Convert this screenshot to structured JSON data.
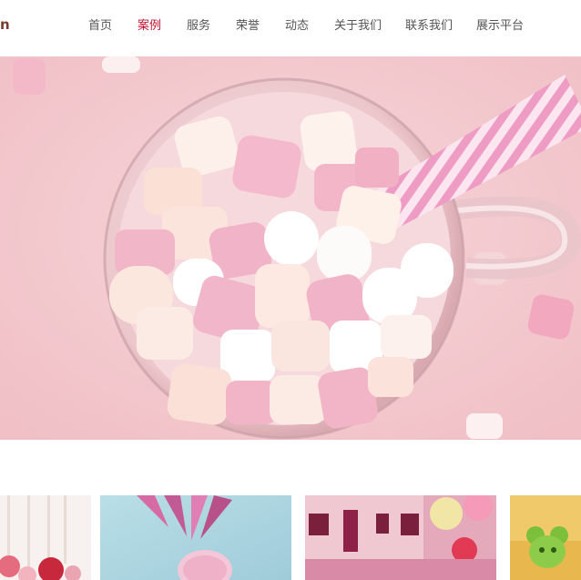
{
  "logo": {
    "text": "n"
  },
  "nav": {
    "items": [
      {
        "label": "首页",
        "active": false
      },
      {
        "label": "案例",
        "active": true
      },
      {
        "label": "服务",
        "active": false
      },
      {
        "label": "荣誉",
        "active": false
      },
      {
        "label": "动态",
        "active": false
      },
      {
        "label": "关于我们",
        "active": false
      },
      {
        "label": "联系我们",
        "active": false
      },
      {
        "label": "展示平台",
        "active": false
      }
    ],
    "active_color": "#c0102a",
    "text_color": "#555555"
  },
  "hero": {
    "subject": "marshmallows in glass mug with pink striped straw"
  },
  "thumbnails": [
    {
      "subject": "cake pops"
    },
    {
      "subject": "pink pineapple"
    },
    {
      "subject": "candy house"
    },
    {
      "subject": "gummy bear"
    }
  ]
}
